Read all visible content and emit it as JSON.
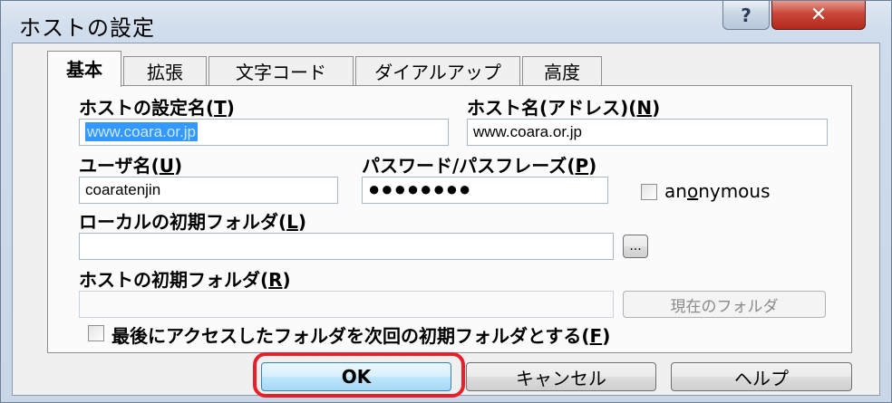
{
  "window": {
    "title": "ホストの設定",
    "help_glyph": "?",
    "close_glyph": "✕"
  },
  "tabs": [
    {
      "label": "基本",
      "active": true
    },
    {
      "label": "拡張",
      "active": false
    },
    {
      "label": "文字コード",
      "active": false
    },
    {
      "label": "ダイアルアップ",
      "active": false
    },
    {
      "label": "高度",
      "active": false
    }
  ],
  "form": {
    "setting_name": {
      "label": "ホストの設定名",
      "mnemonic": "T",
      "value": "www.coara.or.jp"
    },
    "host_name": {
      "label": "ホスト名(アドレス)",
      "mnemonic": "N",
      "value": "www.coara.or.jp"
    },
    "user_name": {
      "label": "ユーザ名",
      "mnemonic": "U",
      "value": "coaratenjin"
    },
    "password": {
      "label": "パスワード/パスフレーズ",
      "mnemonic": "P",
      "value": "●●●●●●●●"
    },
    "anonymous": {
      "label_pre": "an",
      "mnemonic": "o",
      "label_post": "nymous",
      "checked": false
    },
    "local_folder": {
      "label": "ローカルの初期フォルダ",
      "mnemonic": "L",
      "value": "",
      "browse_label": "..."
    },
    "host_folder": {
      "label": "ホストの初期フォルダ",
      "mnemonic": "R",
      "value": "",
      "current_folder_label": "現在のフォルダ"
    },
    "last_folder": {
      "label": "最後にアクセスしたフォルダを次回の初期フォルダとする",
      "mnemonic": "F",
      "checked": false
    }
  },
  "buttons": {
    "ok": "OK",
    "cancel": "キャンセル",
    "help": "ヘルプ"
  },
  "colors": {
    "selection": "#3399ff",
    "highlight_ring": "#e8202a",
    "close_button": "#c8473a"
  }
}
